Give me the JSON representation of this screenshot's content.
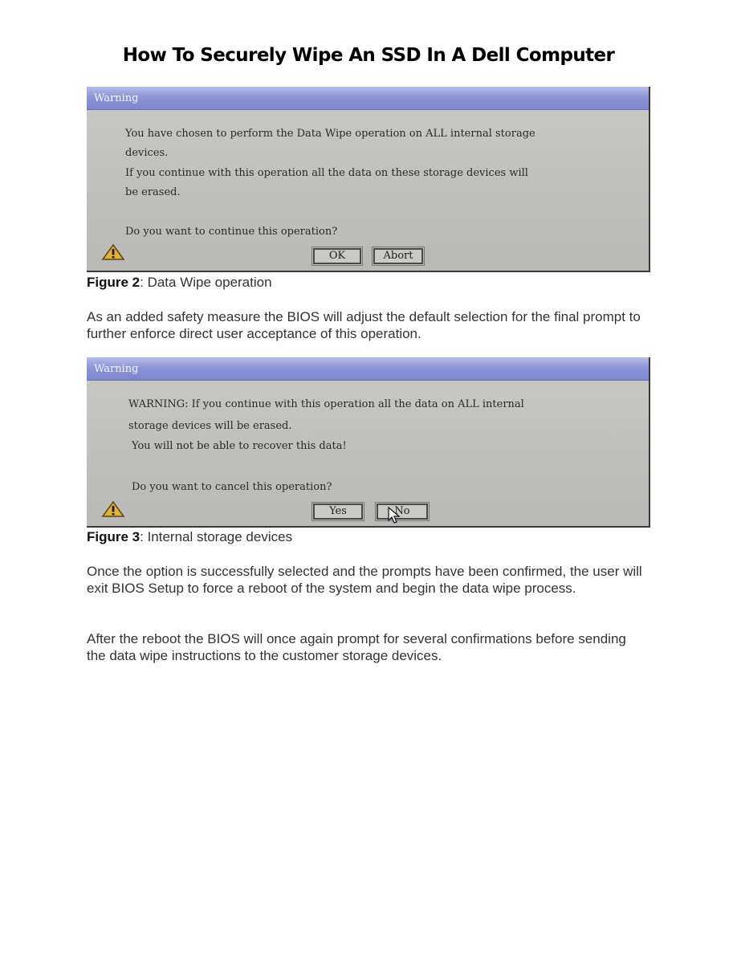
{
  "page": {
    "title": "How To Securely Wipe An SSD In A Dell Computer"
  },
  "figure2": {
    "dialog_title": "Warning",
    "lines": [
      "You have chosen to perform the Data Wipe operation on ALL internal storage",
      "devices.",
      "If you continue with this operation all the data on these storage devices will",
      "be erased.",
      "Do you want to continue this operation?"
    ],
    "buttons": {
      "ok": "OK",
      "abort": "Abort"
    },
    "caption_label": "Figure 2",
    "caption_text": ": Data Wipe operation"
  },
  "para1": "As an added safety measure the BIOS will adjust the default selection for the final prompt to further enforce direct user acceptance of this operation.",
  "figure3": {
    "dialog_title": "Warning",
    "lines": [
      "WARNING: If you continue with this operation all the data on ALL internal",
      "storage devices will be erased.",
      "You will not be able to recover this data!",
      "Do you want to cancel this operation?"
    ],
    "buttons": {
      "yes": "Yes",
      "no": "No"
    },
    "caption_label": "Figure 3",
    "caption_text": ": Internal storage devices"
  },
  "para2": "Once the option is successfully selected and the prompts have been confirmed, the user will exit BIOS Setup to force a reboot of the system and begin the data wipe process.",
  "para3": "After the reboot the BIOS will once again prompt for several confirmations before sending the data wipe instructions to the customer storage devices.",
  "icons": {
    "warning": "warning-triangle-icon",
    "cursor": "mouse-pointer-icon"
  },
  "colors": {
    "titlebar": "#8d95d8",
    "dialog_bg": "#c5c5c2"
  }
}
